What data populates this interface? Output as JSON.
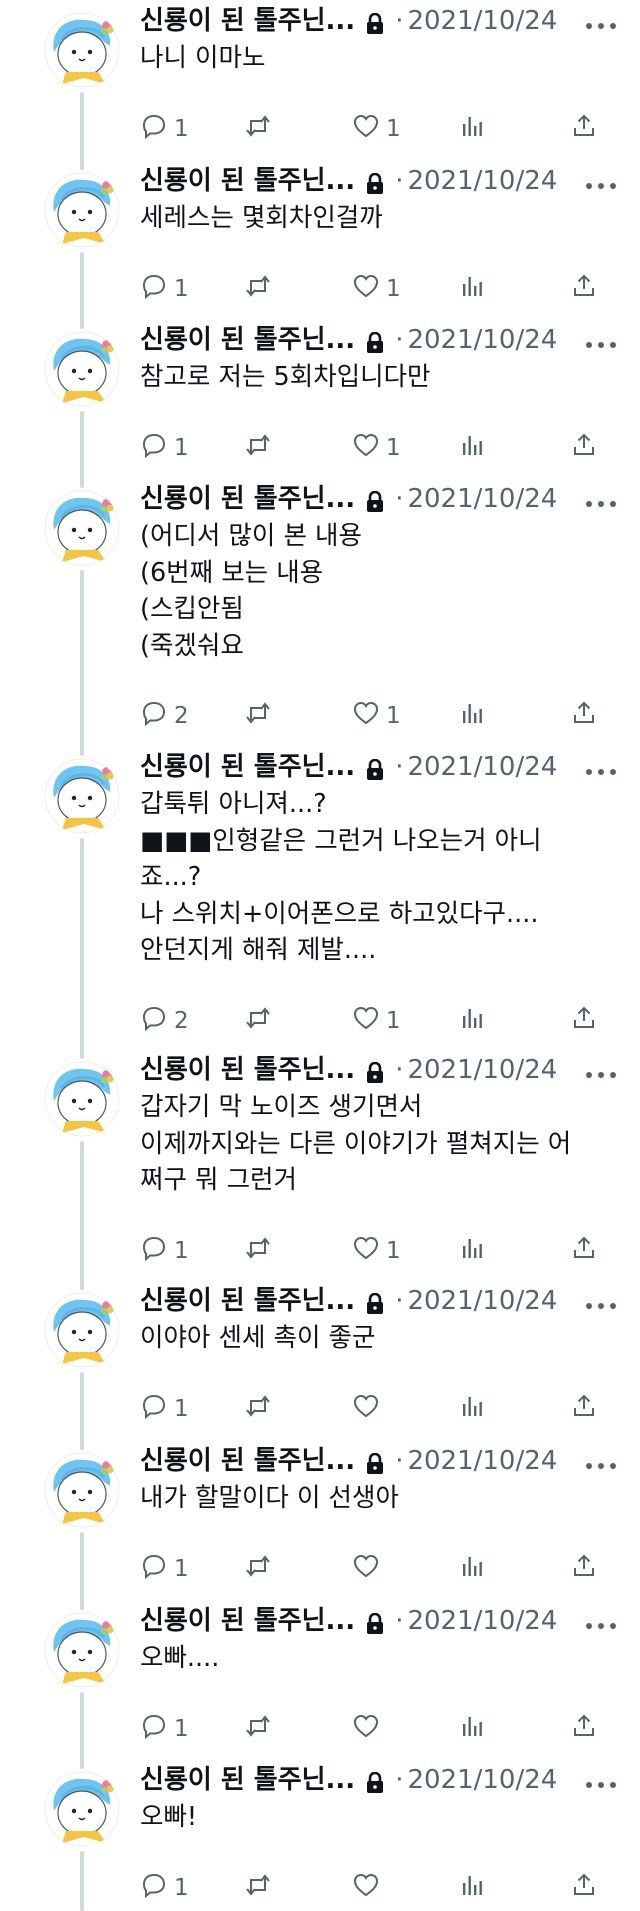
{
  "tweets": [
    {
      "name": "신룡이 된 톨주닌...",
      "date": "2021/10/24",
      "separator": "·",
      "lines": [
        "나니 이마노"
      ],
      "replies": "1",
      "likes": "1"
    },
    {
      "name": "신룡이 된 톨주닌...",
      "date": "2021/10/24",
      "separator": "·",
      "lines": [
        "세레스는 몇회차인걸까"
      ],
      "replies": "1",
      "likes": "1"
    },
    {
      "name": "신룡이 된 톨주닌...",
      "date": "2021/10/24",
      "separator": "·",
      "lines": [
        "참고로 저는 5회차입니다만"
      ],
      "replies": "1",
      "likes": "1"
    },
    {
      "name": "신룡이 된 톨주닌...",
      "date": "2021/10/24",
      "separator": "·",
      "lines": [
        "(어디서 많이 본 내용",
        "(6번째 보는 내용",
        "(스킵안됨",
        "(죽겠숴요"
      ],
      "replies": "2",
      "likes": "1"
    },
    {
      "name": "신룡이 된 톨주닌...",
      "date": "2021/10/24",
      "separator": "·",
      "lines": [
        "갑툭튀 아니져...?",
        "■■■인형같은 그런거 나오는거 아니",
        "죠...?",
        "나 스위치+이어폰으로 하고있다구....",
        "안던지게 해줘 제발...."
      ],
      "replies": "2",
      "likes": "1"
    },
    {
      "name": "신룡이 된 톨주닌...",
      "date": "2021/10/24",
      "separator": "·",
      "lines": [
        "갑자기 막 노이즈 생기면서",
        "이제까지와는 다른 이야기가 펼쳐지는 어",
        "쩌구 뭐 그런거"
      ],
      "replies": "1",
      "likes": "1"
    },
    {
      "name": "신룡이 된 톨주닌...",
      "date": "2021/10/24",
      "separator": "·",
      "lines": [
        "이야아 센세 촉이 좋군"
      ],
      "replies": "1",
      "likes": ""
    },
    {
      "name": "신룡이 된 톨주닌...",
      "date": "2021/10/24",
      "separator": "·",
      "lines": [
        "내가 할말이다 이 선생아"
      ],
      "replies": "1",
      "likes": ""
    },
    {
      "name": "신룡이 된 톨주닌...",
      "date": "2021/10/24",
      "separator": "·",
      "lines": [
        "오빠...."
      ],
      "replies": "1",
      "likes": ""
    },
    {
      "name": "신룡이 된 톨주닌...",
      "date": "2021/10/24",
      "separator": "·",
      "lines": [
        "오빠!"
      ],
      "replies": "1",
      "likes": ""
    }
  ]
}
